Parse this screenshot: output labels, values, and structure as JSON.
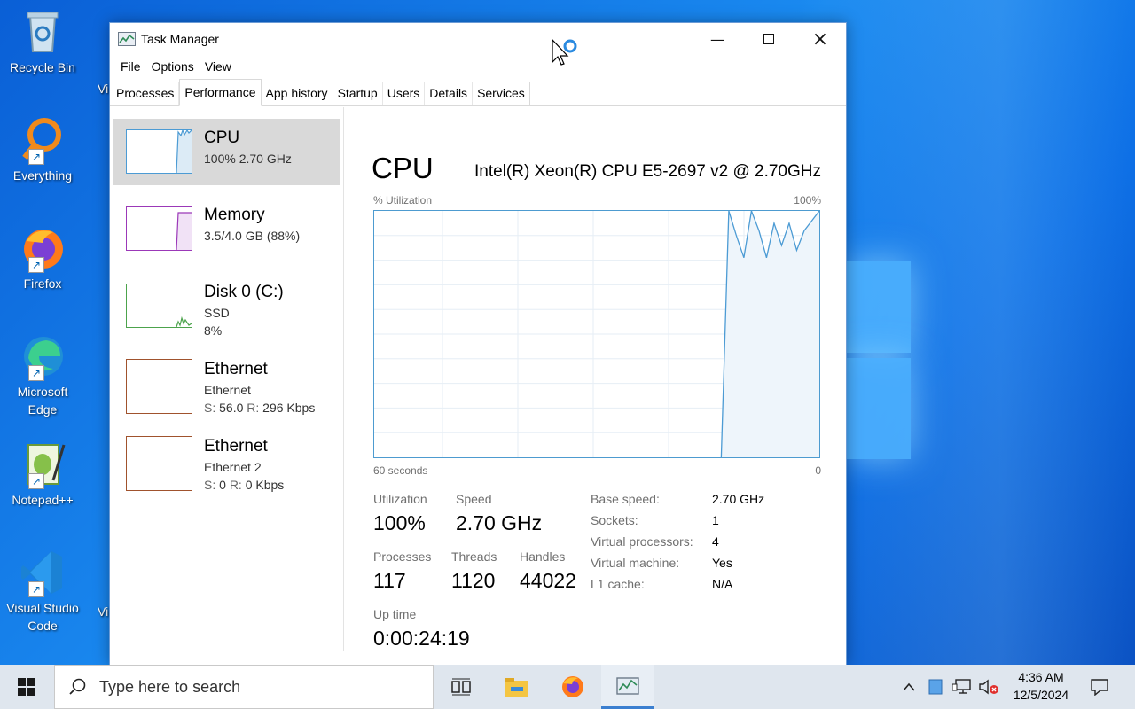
{
  "desktop": {
    "icons": [
      {
        "label": "Recycle Bin"
      },
      {
        "label": "Everything"
      },
      {
        "label": "Firefox"
      },
      {
        "label": "Microsoft Edge"
      },
      {
        "label": "Notepad++"
      },
      {
        "label": "Visual Studio Code"
      }
    ],
    "partial_icon_labels": [
      "Vi",
      "Vi"
    ]
  },
  "window": {
    "title": "Task Manager",
    "menu": [
      "File",
      "Options",
      "View"
    ],
    "tabs": [
      "Processes",
      "Performance",
      "App history",
      "Startup",
      "Users",
      "Details",
      "Services"
    ],
    "active_tab": "Performance"
  },
  "sidebar": {
    "items": [
      {
        "name": "CPU",
        "line1": "100%  2.70 GHz",
        "line2": "",
        "color": "#4c9bd4",
        "selected": true
      },
      {
        "name": "Memory",
        "line1": "3.5/4.0 GB (88%)",
        "line2": "",
        "color": "#9b38b8"
      },
      {
        "name": "Disk 0 (C:)",
        "line1": "SSD",
        "line2": "8%",
        "color": "#4ca34c"
      },
      {
        "name": "Ethernet",
        "line1": "Ethernet",
        "send_label": "S:",
        "send": "56.0",
        "recv_label": "R:",
        "recv": "296 Kbps",
        "color": "#a0522d"
      },
      {
        "name": "Ethernet",
        "line1": "Ethernet 2",
        "send_label": "S:",
        "send": "0",
        "recv_label": "R:",
        "recv": "0 Kbps",
        "color": "#a0522d"
      }
    ]
  },
  "main": {
    "title": "CPU",
    "model": "Intel(R) Xeon(R) CPU E5-2697 v2 @ 2.70GHz",
    "graph": {
      "top_left": "% Utilization",
      "top_right": "100%",
      "bottom_left": "60 seconds",
      "bottom_right": "0",
      "line_color": "#4c9bd4",
      "fill_color": "#eef5fb",
      "series": [
        0,
        0,
        0,
        0,
        0,
        0,
        0,
        0,
        0,
        0,
        0,
        0,
        0,
        0,
        0,
        0,
        0,
        0,
        0,
        0,
        0,
        0,
        0,
        0,
        0,
        0,
        0,
        0,
        0,
        0,
        0,
        0,
        0,
        0,
        0,
        0,
        0,
        0,
        0,
        0,
        0,
        0,
        0,
        0,
        0,
        0,
        0,
        100,
        90,
        81,
        100,
        92,
        81,
        95,
        86,
        95,
        84,
        92,
        96,
        100
      ]
    },
    "stats": {
      "utilization_label": "Utilization",
      "utilization": "100%",
      "speed_label": "Speed",
      "speed": "2.70 GHz",
      "processes_label": "Processes",
      "processes": "117",
      "threads_label": "Threads",
      "threads": "1120",
      "handles_label": "Handles",
      "handles": "44022",
      "uptime_label": "Up time",
      "uptime": "0:00:24:19"
    },
    "details": [
      {
        "label": "Base speed:",
        "value": "2.70 GHz"
      },
      {
        "label": "Sockets:",
        "value": "1"
      },
      {
        "label": "Virtual processors:",
        "value": "4"
      },
      {
        "label": "Virtual machine:",
        "value": "Yes"
      },
      {
        "label": "L1 cache:",
        "value": "N/A"
      }
    ]
  },
  "taskbar": {
    "search_placeholder": "Type here to search",
    "time": "4:36 AM",
    "date": "12/5/2024"
  }
}
